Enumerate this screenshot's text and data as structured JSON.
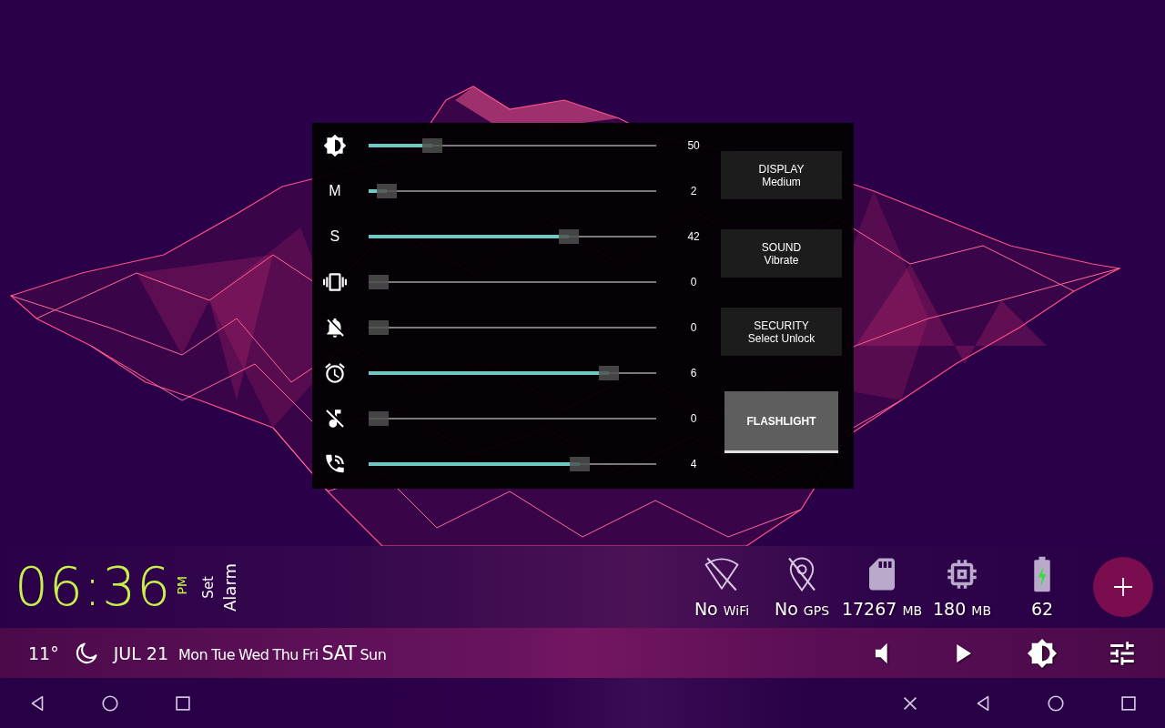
{
  "quick_panel": {
    "sliders": [
      {
        "kind": "brightness",
        "level": 0.2,
        "reading": "50"
      },
      {
        "kind": "letter",
        "label": "M",
        "level": 0.03,
        "reading": "2"
      },
      {
        "kind": "letter",
        "label": "S",
        "level": 0.71,
        "reading": "42"
      },
      {
        "kind": "vibrate",
        "level": 0,
        "reading": "0"
      },
      {
        "kind": "notifications_off",
        "level": 0,
        "reading": "0"
      },
      {
        "kind": "alarm",
        "level": 0.86,
        "reading": "6"
      },
      {
        "kind": "music_off",
        "level": 0,
        "reading": "0"
      },
      {
        "kind": "call",
        "level": 0.75,
        "reading": "4"
      }
    ],
    "buttons": [
      {
        "kind": "mode",
        "title": "DISPLAY",
        "value": "Medium"
      },
      {
        "kind": "mode",
        "title": "SOUND",
        "value": "Vibrate"
      },
      {
        "kind": "mode",
        "title": "SECURITY",
        "value": "Select Unlock"
      },
      {
        "kind": "toggle",
        "title": "FLASHLIGHT"
      }
    ]
  },
  "clock": {
    "time": "06:36",
    "meridiem": "PM",
    "alarm_lines": [
      "Set",
      "Alarm"
    ]
  },
  "status": [
    {
      "kind": "wifi_off",
      "value": "No",
      "unit": "WiFi"
    },
    {
      "kind": "gps_off",
      "value": "No",
      "unit": "GPS"
    },
    {
      "kind": "storage",
      "value": "17267",
      "unit": "MB"
    },
    {
      "kind": "memory",
      "value": "180",
      "unit": "MB"
    },
    {
      "kind": "battery",
      "value": "62"
    }
  ],
  "date_bar": {
    "temperature": "11°",
    "date": "JUL 21",
    "days": [
      {
        "label": "Mon",
        "selected": false
      },
      {
        "label": "Tue",
        "selected": false
      },
      {
        "label": "Wed",
        "selected": false
      },
      {
        "label": "Thu",
        "selected": false
      },
      {
        "label": "Fri",
        "selected": false
      },
      {
        "label": "SAT",
        "selected": true
      },
      {
        "label": "Sun",
        "selected": false
      }
    ]
  }
}
